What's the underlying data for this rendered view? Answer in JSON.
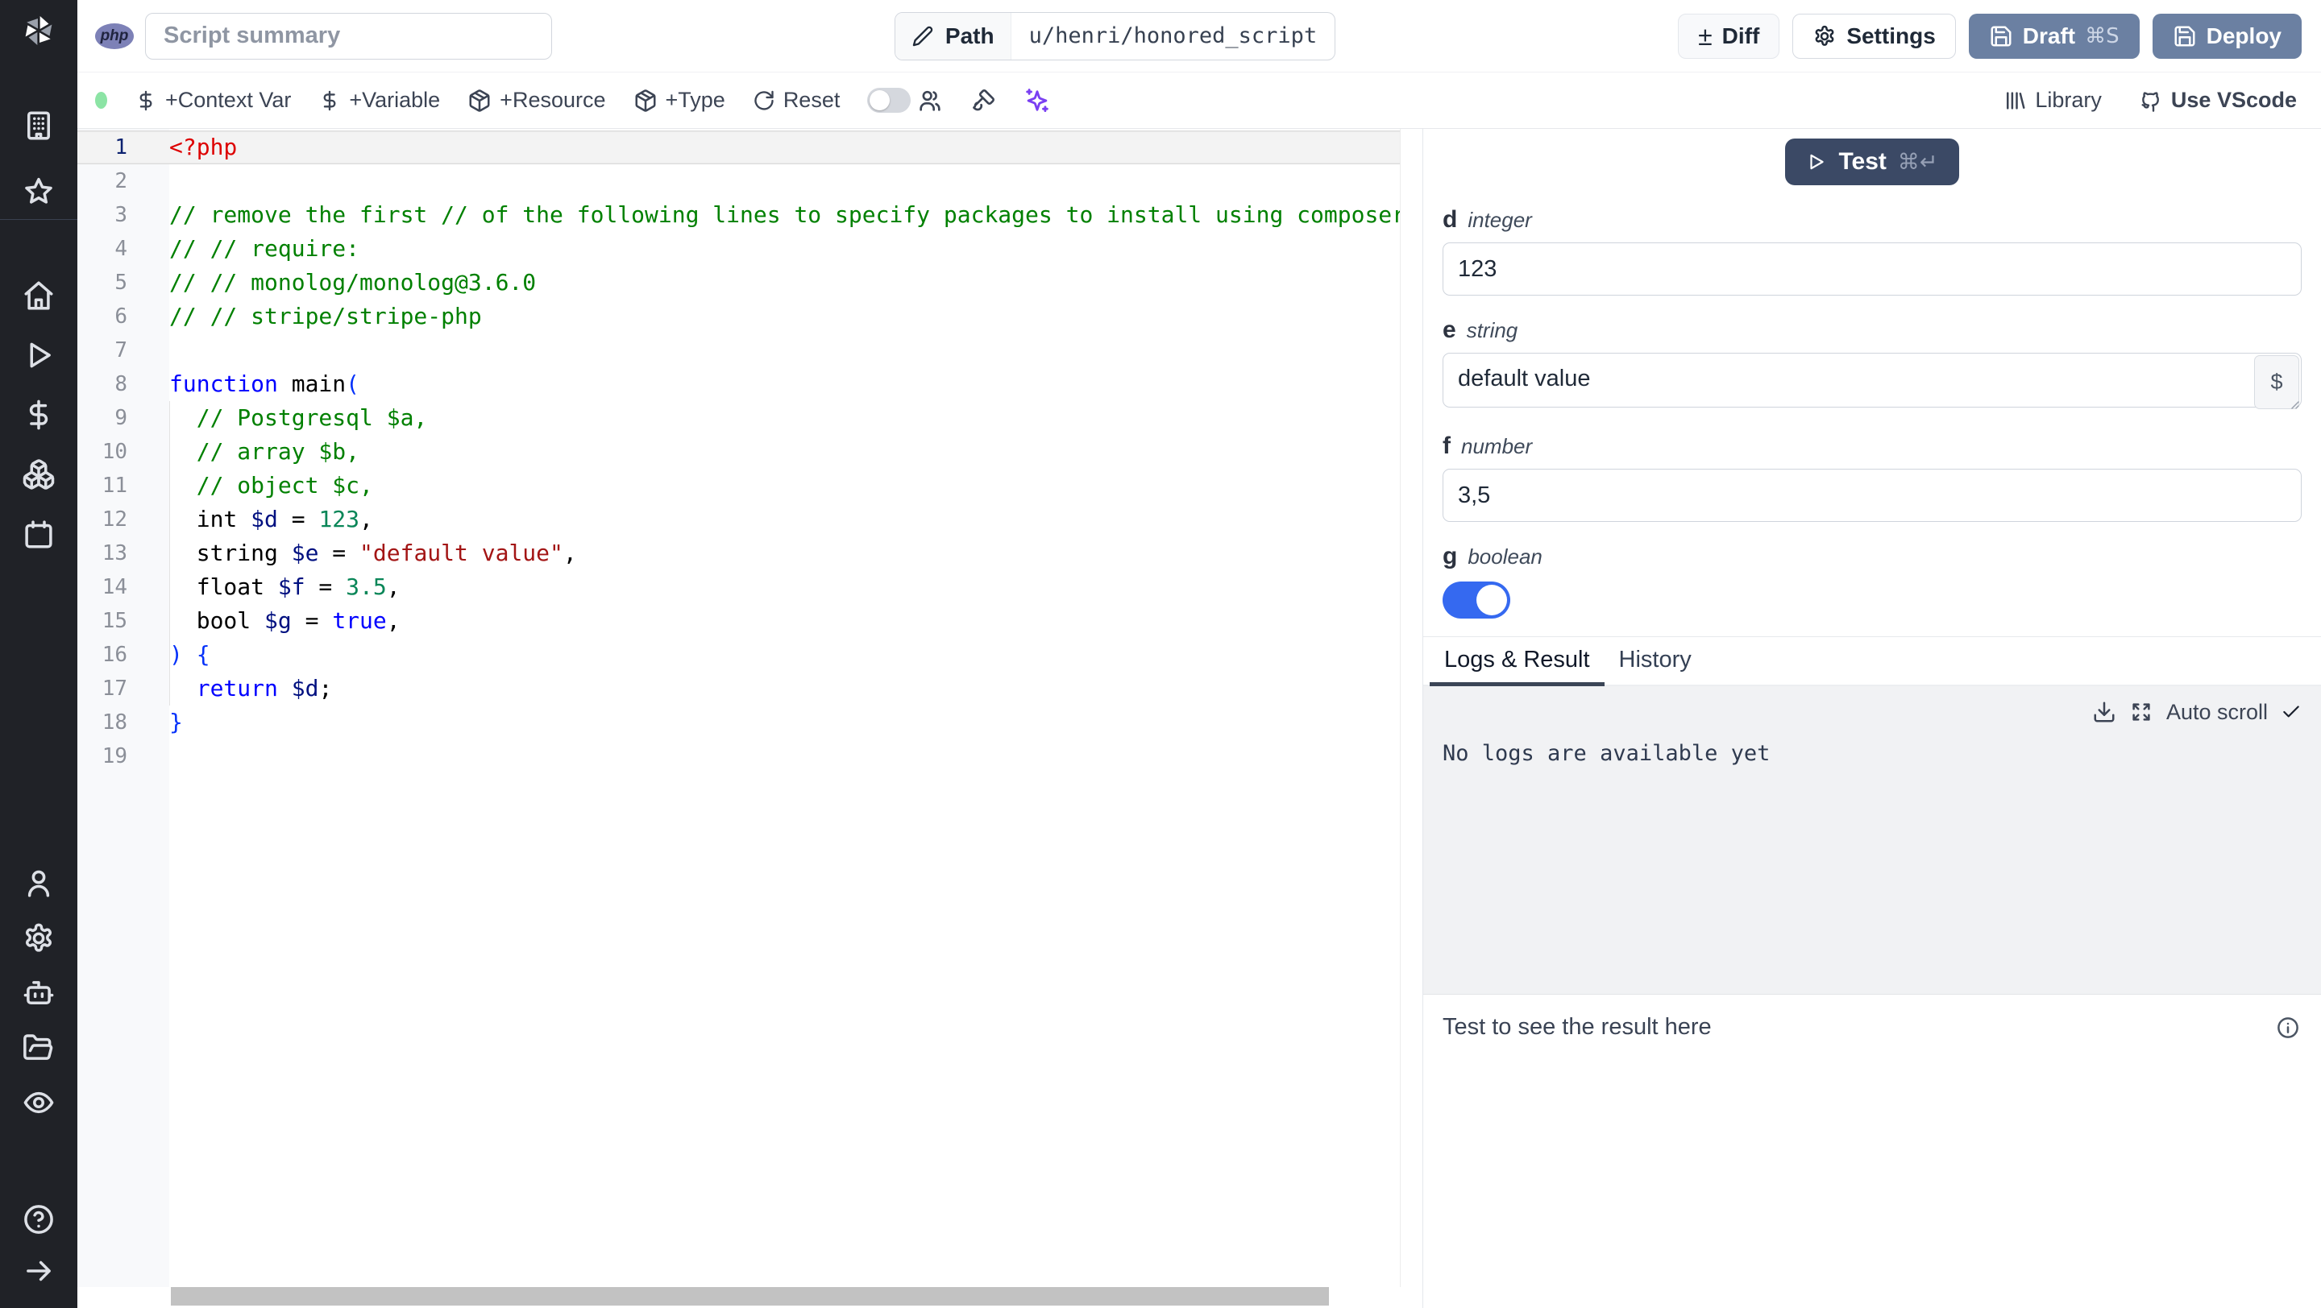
{
  "colors": {
    "sidebar_bg": "#202227",
    "deploy_button_bg": "#6b80a2",
    "test_button_bg": "#3b4965",
    "toggle_on_blue": "#3569f0",
    "status_dot_green": "#8ce4a5",
    "ai_icon_purple": "#7a3ff2",
    "active_tab_underline": "#3b4556"
  },
  "header": {
    "language_badge": "php",
    "summary_placeholder": "Script summary",
    "path_label": "Path",
    "path_value": "u/henri/honored_script",
    "diff_label": "Diff",
    "diff_icon_glyph": "±",
    "settings_label": "Settings",
    "draft_label": "Draft",
    "draft_shortcut": "⌘S",
    "deploy_label": "Deploy"
  },
  "toolbar": {
    "context_var_label": "+Context Var",
    "variable_label": "+Variable",
    "resource_label": "+Resource",
    "type_label": "+Type",
    "reset_label": "Reset",
    "library_label": "Library",
    "vscode_label": "Use VScode"
  },
  "sidebar": {
    "icons": [
      "windmill-logo",
      "building",
      "star",
      "home",
      "play",
      "dollar-sign",
      "boxes",
      "calendar",
      "user",
      "gear",
      "robot",
      "folder-open",
      "eye",
      "help-circle",
      "arrow-right"
    ]
  },
  "editor": {
    "language": "php",
    "lines": [
      {
        "n": 1,
        "active": true,
        "tokens": [
          {
            "t": "<?php",
            "c": "tag"
          }
        ]
      },
      {
        "n": 2,
        "tokens": []
      },
      {
        "n": 3,
        "tokens": [
          {
            "t": "// remove the first // of the following lines to specify packages to install using composer",
            "c": "comment"
          }
        ]
      },
      {
        "n": 4,
        "tokens": [
          {
            "t": "// // require:",
            "c": "comment"
          }
        ]
      },
      {
        "n": 5,
        "tokens": [
          {
            "t": "// // monolog/monolog@3.6.0",
            "c": "comment"
          }
        ]
      },
      {
        "n": 6,
        "tokens": [
          {
            "t": "// // stripe/stripe-php",
            "c": "comment"
          }
        ]
      },
      {
        "n": 7,
        "tokens": []
      },
      {
        "n": 8,
        "tokens": [
          {
            "t": "function",
            "c": "kw"
          },
          {
            "t": " main",
            "c": "plain"
          },
          {
            "t": "(",
            "c": "brk"
          }
        ]
      },
      {
        "n": 9,
        "tokens": [
          {
            "t": "  // Postgresql $a,",
            "c": "comment"
          }
        ]
      },
      {
        "n": 10,
        "tokens": [
          {
            "t": "  // array $b,",
            "c": "comment"
          }
        ]
      },
      {
        "n": 11,
        "tokens": [
          {
            "t": "  // object $c,",
            "c": "comment"
          }
        ]
      },
      {
        "n": 12,
        "tokens": [
          {
            "t": "  int ",
            "c": "plain"
          },
          {
            "t": "$d",
            "c": "var"
          },
          {
            "t": " = ",
            "c": "plain"
          },
          {
            "t": "123",
            "c": "num"
          },
          {
            "t": ",",
            "c": "plain"
          }
        ]
      },
      {
        "n": 13,
        "tokens": [
          {
            "t": "  string ",
            "c": "plain"
          },
          {
            "t": "$e",
            "c": "var"
          },
          {
            "t": " = ",
            "c": "plain"
          },
          {
            "t": "\"default value\"",
            "c": "str"
          },
          {
            "t": ",",
            "c": "plain"
          }
        ]
      },
      {
        "n": 14,
        "tokens": [
          {
            "t": "  float ",
            "c": "plain"
          },
          {
            "t": "$f",
            "c": "var"
          },
          {
            "t": " = ",
            "c": "plain"
          },
          {
            "t": "3.5",
            "c": "num"
          },
          {
            "t": ",",
            "c": "plain"
          }
        ]
      },
      {
        "n": 15,
        "tokens": [
          {
            "t": "  bool ",
            "c": "plain"
          },
          {
            "t": "$g",
            "c": "var"
          },
          {
            "t": " = ",
            "c": "plain"
          },
          {
            "t": "true",
            "c": "kw"
          },
          {
            "t": ",",
            "c": "plain"
          }
        ]
      },
      {
        "n": 16,
        "tokens": [
          {
            "t": ")",
            "c": "brk"
          },
          {
            "t": " ",
            "c": "plain"
          },
          {
            "t": "{",
            "c": "brk"
          }
        ]
      },
      {
        "n": 17,
        "tokens": [
          {
            "t": "  ",
            "c": "plain"
          },
          {
            "t": "return",
            "c": "kw"
          },
          {
            "t": " ",
            "c": "plain"
          },
          {
            "t": "$d",
            "c": "var"
          },
          {
            "t": ";",
            "c": "plain"
          }
        ]
      },
      {
        "n": 18,
        "tokens": [
          {
            "t": "}",
            "c": "brk"
          }
        ]
      },
      {
        "n": 19,
        "tokens": []
      }
    ]
  },
  "run_panel": {
    "test_button": {
      "label": "Test",
      "shortcut": "⌘↵"
    },
    "args": [
      {
        "name": "d",
        "type": "integer",
        "value": "123"
      },
      {
        "name": "e",
        "type": "string",
        "value": "default value",
        "suffix_button": "$"
      },
      {
        "name": "f",
        "type": "number",
        "value": "3,5"
      },
      {
        "name": "g",
        "type": "boolean",
        "value": "on"
      }
    ],
    "tabs": [
      {
        "label": "Logs & Result",
        "active": true
      },
      {
        "label": "History",
        "active": false
      }
    ],
    "logs": {
      "autoscroll_label": "Auto scroll",
      "empty_message": "No logs are available yet"
    },
    "result": {
      "placeholder": "Test to see the result here"
    }
  }
}
